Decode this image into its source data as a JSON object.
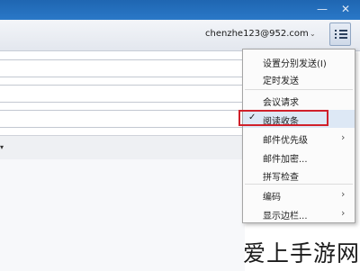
{
  "window": {
    "min_glyph": "—",
    "close_glyph": "✕"
  },
  "header": {
    "account_email": "chenzhe123@952.com",
    "account_dropdown_glyph": "⌄",
    "menu_icon": "list-menu-icon"
  },
  "compose": {
    "toolstrip_arrow_glyph": "▾"
  },
  "menu": {
    "items": [
      {
        "label": "设置分别发送(I)",
        "checked": false,
        "submenu": false
      },
      {
        "label": "定时发送",
        "checked": false,
        "submenu": false
      },
      {
        "label": "会议请求",
        "checked": false,
        "submenu": false
      },
      {
        "label": "阅读收条",
        "checked": true,
        "submenu": false
      },
      {
        "label": "邮件优先级",
        "checked": false,
        "submenu": true
      },
      {
        "label": "邮件加密...",
        "checked": false,
        "submenu": false
      },
      {
        "label": "拼写检查",
        "checked": false,
        "submenu": false
      },
      {
        "label": "编码",
        "checked": false,
        "submenu": true
      },
      {
        "label": "显示边栏...",
        "checked": false,
        "submenu": true
      }
    ],
    "check_glyph": "✓",
    "submenu_glyph": "›"
  },
  "watermark": {
    "text": "爱上手游网"
  },
  "colors": {
    "titlebar": "#1f66b1",
    "highlight_border": "#d0202a"
  }
}
